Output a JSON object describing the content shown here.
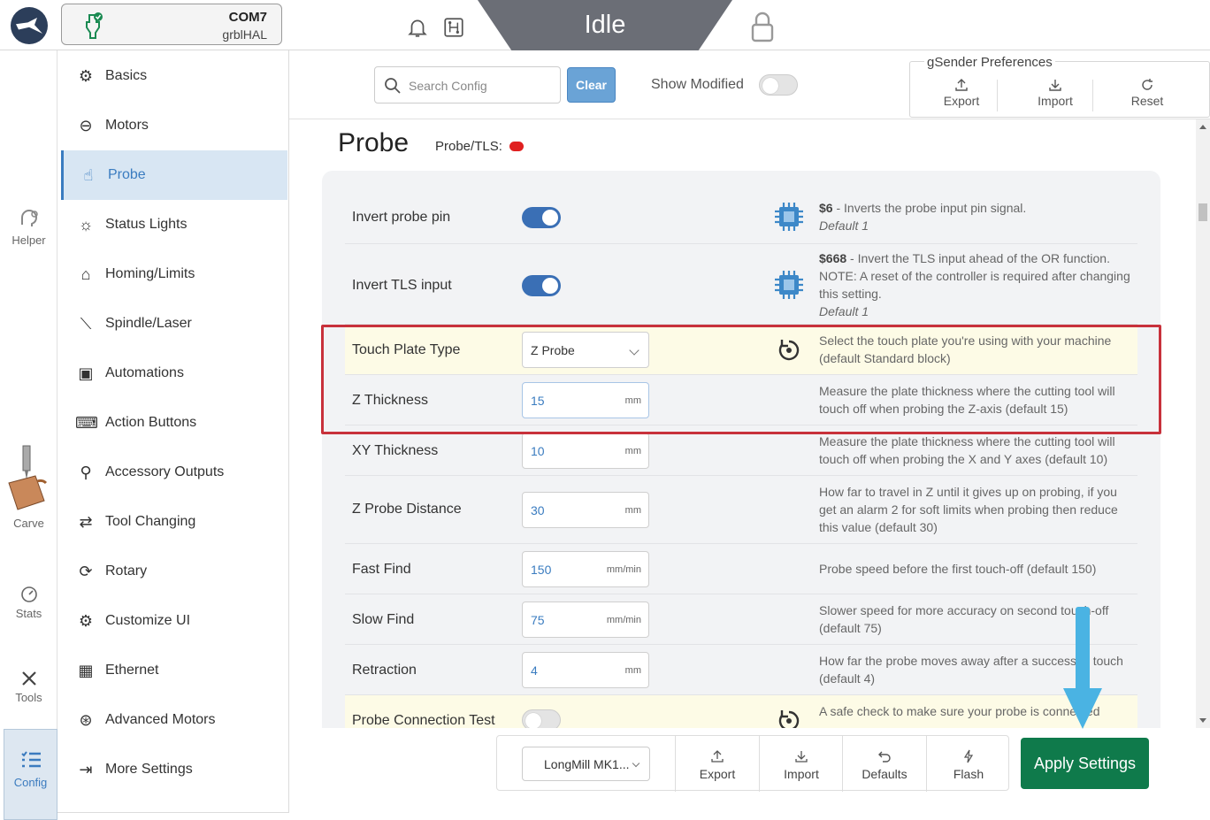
{
  "topbar": {
    "port": "COM7",
    "firmware": "grblHAL",
    "state": "Idle"
  },
  "rail": {
    "helper": "Helper",
    "carve": "Carve",
    "stats": "Stats",
    "tools": "Tools",
    "config": "Config"
  },
  "sidebar": {
    "items": [
      {
        "label": "Basics",
        "icon": "gear-icon"
      },
      {
        "label": "Motors",
        "icon": "motor-icon"
      },
      {
        "label": "Probe",
        "icon": "touch-icon"
      },
      {
        "label": "Status Lights",
        "icon": "light-icon"
      },
      {
        "label": "Homing/Limits",
        "icon": "home-icon"
      },
      {
        "label": "Spindle/Laser",
        "icon": "spindle-icon"
      },
      {
        "label": "Automations",
        "icon": "robot-icon"
      },
      {
        "label": "Action Buttons",
        "icon": "keyboard-icon"
      },
      {
        "label": "Accessory Outputs",
        "icon": "pin-icon"
      },
      {
        "label": "Tool Changing",
        "icon": "swap-icon"
      },
      {
        "label": "Rotary",
        "icon": "rotary-icon"
      },
      {
        "label": "Customize UI",
        "icon": "customize-icon"
      },
      {
        "label": "Ethernet",
        "icon": "ethernet-icon"
      },
      {
        "label": "Advanced Motors",
        "icon": "advanced-motor-icon"
      },
      {
        "label": "More Settings",
        "icon": "more-settings-icon"
      }
    ]
  },
  "header": {
    "search_placeholder": "Search Config",
    "clear": "Clear",
    "show_modified": "Show Modified",
    "prefs_title": "gSender Preferences",
    "export": "Export",
    "import": "Import",
    "reset": "Reset"
  },
  "section": {
    "title": "Probe",
    "status_label": "Probe/TLS:",
    "status_color": "#e02020"
  },
  "rows": [
    {
      "label": "Invert probe pin",
      "code": "$6",
      "desc": " - Inverts the probe input pin signal.",
      "default": "Default 1"
    },
    {
      "label": "Invert TLS input",
      "code": "$668",
      "desc": " - Invert the TLS input ahead of the OR function. NOTE: A reset of the controller is required after changing this setting.",
      "default": "Default 1"
    },
    {
      "label": "Touch Plate Type",
      "value": "Z Probe",
      "desc": "Select the touch plate you're using with your machine (default Standard block)"
    },
    {
      "label": "Z Thickness",
      "value": "15",
      "unit": "mm",
      "desc": "Measure the plate thickness where the cutting tool will touch off when probing the Z-axis (default 15)"
    },
    {
      "label": "XY Thickness",
      "value": "10",
      "unit": "mm",
      "desc": "Measure the plate thickness where the cutting tool will touch off when probing the X and Y axes (default 10)"
    },
    {
      "label": "Z Probe Distance",
      "value": "30",
      "unit": "mm",
      "desc": "How far to travel in Z until it gives up on probing, if you get an alarm 2 for soft limits when probing then reduce this value (default 30)"
    },
    {
      "label": "Fast Find",
      "value": "150",
      "unit": "mm/min",
      "desc": "Probe speed before the first touch-off (default 150)"
    },
    {
      "label": "Slow Find",
      "value": "75",
      "unit": "mm/min",
      "desc": "Slower speed for more accuracy on second touch-off (default 75)"
    },
    {
      "label": "Retraction",
      "value": "4",
      "unit": "mm",
      "desc": "How far the probe moves away after a successful touch (default 4)"
    },
    {
      "label": "Probe Connection Test",
      "desc": "A safe check to make sure your probe is connected"
    }
  ],
  "footer": {
    "machine": "LongMill MK1...",
    "export": "Export",
    "import": "Import",
    "defaults": "Defaults",
    "flash": "Flash",
    "apply": "Apply Settings"
  },
  "colors": {
    "accent": "#3a7cc0",
    "apply": "#0f7a4b",
    "highlight": "#c8313b",
    "arrow": "#4ab3e3"
  }
}
